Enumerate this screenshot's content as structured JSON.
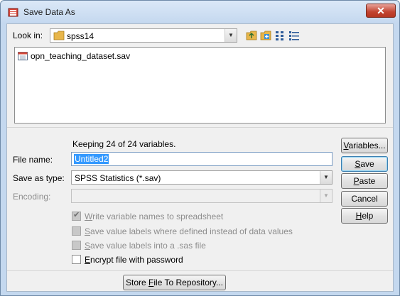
{
  "window": {
    "title": "Save Data As",
    "close_label": "✕"
  },
  "look_in": {
    "label": "Look in:",
    "folder": "spss14"
  },
  "toolbar": {
    "icons": [
      "up-folder-icon",
      "new-folder-icon",
      "list-view-icon",
      "details-view-icon"
    ]
  },
  "files": [
    {
      "name": "opn_teaching_dataset.sav",
      "icon": "sav-file-icon"
    }
  ],
  "info": {
    "keeping_text": "Keeping 24 of 24 variables."
  },
  "file_name": {
    "label": "File name:",
    "value": "Untitled2"
  },
  "save_as_type": {
    "label": "Save as type:",
    "value": "SPSS Statistics (*.sav)"
  },
  "encoding": {
    "label": "Encoding:",
    "value": ""
  },
  "options": [
    {
      "label": "Write variable names to spreadsheet",
      "checked": true,
      "enabled": false
    },
    {
      "label": "Save value labels where defined instead of data values",
      "checked": false,
      "enabled": false
    },
    {
      "label": "Save value labels into a .sas file",
      "checked": false,
      "enabled": false
    },
    {
      "label": "Encrypt file with password",
      "checked": false,
      "enabled": true
    }
  ],
  "buttons": {
    "variables": "Variables...",
    "save": "Save",
    "paste": "Paste",
    "cancel": "Cancel",
    "help": "Help",
    "store": "Store File To Repository..."
  }
}
